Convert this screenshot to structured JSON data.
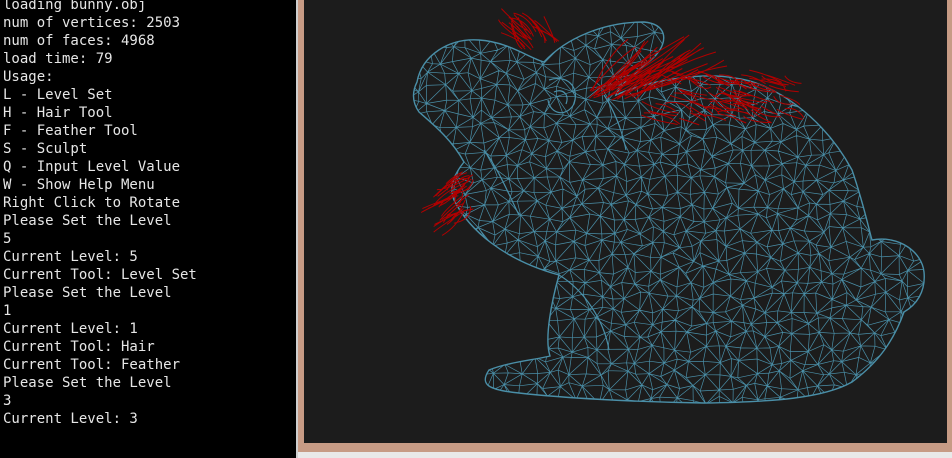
{
  "console": {
    "lines": [
      "loading bunny.obj",
      "num of vertices: 2503",
      "num of faces: 4968",
      "load time: 79",
      "Usage:",
      "L - Level Set",
      "H - Hair Tool",
      "F - Feather Tool",
      "S - Sculpt",
      "Q - Input Level Value",
      "W - Show Help Menu",
      "Right Click to Rotate",
      "Please Set the Level",
      "5",
      "Current Level: 5",
      "Current Tool: Level Set",
      "Please Set the Level",
      "1",
      "Current Level: 1",
      "Current Tool: Hair",
      "Current Tool: Feather",
      "Please Set the Level",
      "3",
      "Current Level: 3"
    ]
  },
  "viewport": {
    "background": "#1c1c1c",
    "frame_color": "#c79b85",
    "mesh_color": "#4a8fa8",
    "hair_color": "#b00000",
    "model": "bunny-wireframe"
  }
}
